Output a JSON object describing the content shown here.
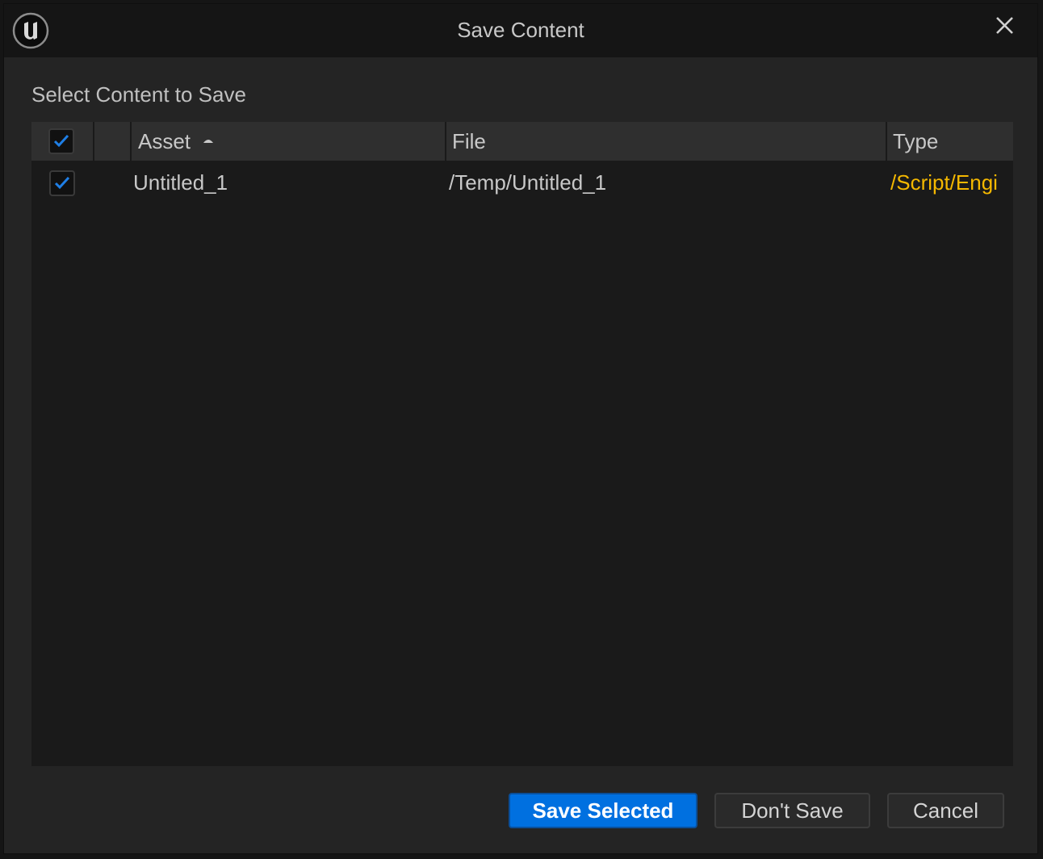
{
  "window": {
    "title": "Save Content",
    "logo": "unreal-engine-logo",
    "close_icon": "close-icon"
  },
  "section_label": "Select Content to Save",
  "table": {
    "select_all_checked": true,
    "columns": [
      {
        "label": "Asset",
        "sort": "ascending"
      },
      {
        "label": "File"
      },
      {
        "label": "Type"
      }
    ],
    "rows": [
      {
        "checked": true,
        "asset": "Untitled_1",
        "file": "/Temp/Untitled_1",
        "type": "/Script/Engi"
      }
    ]
  },
  "buttons": {
    "save_selected": "Save Selected",
    "dont_save": "Don't Save",
    "cancel": "Cancel"
  },
  "colors": {
    "accent": "#0070e0",
    "checkmark": "#1f7fe6",
    "type_text": "#f5b800"
  }
}
